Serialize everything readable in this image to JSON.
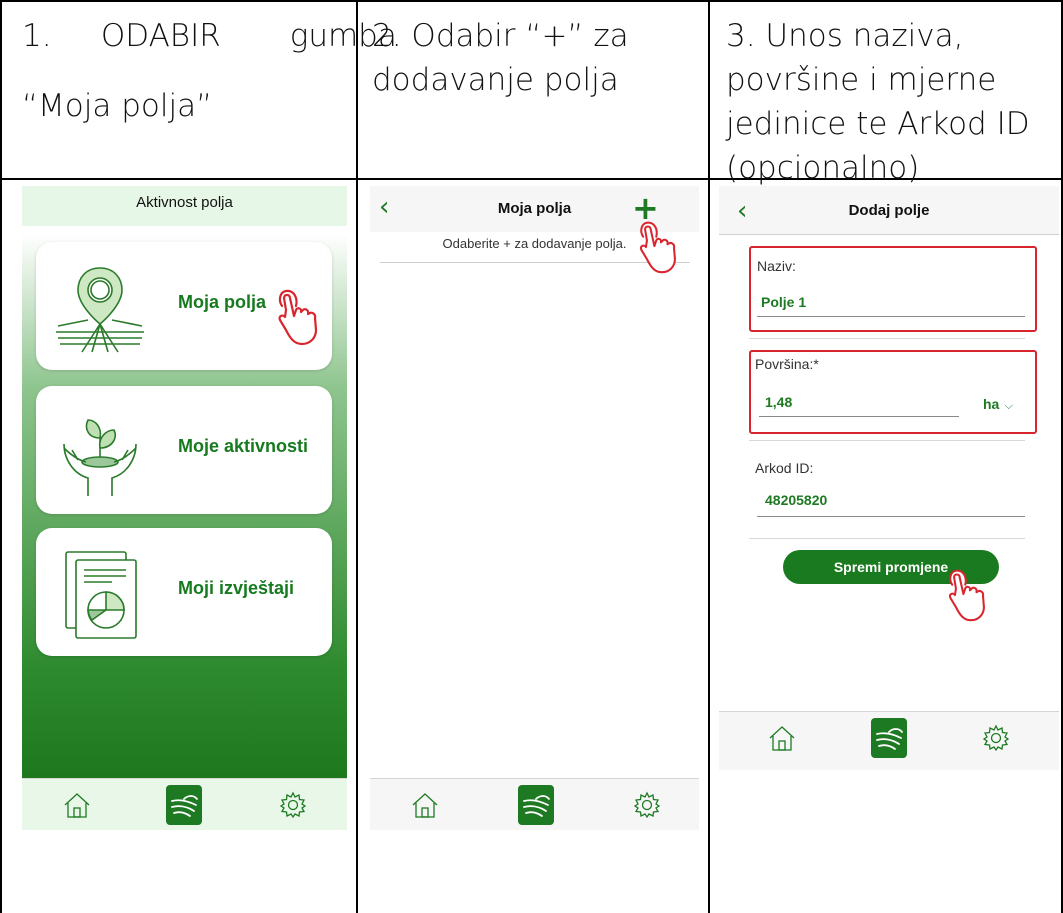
{
  "columns": [
    {
      "step_text": "1.     ODABIR       gumba",
      "step_text_2": "“Moja polja”"
    },
    {
      "step_text": "2. Odabir “+” za",
      "step_text_2": "dodavanje polja"
    },
    {
      "step_text": "3. Unos naziva,",
      "step_text_2": "površine i mjerne",
      "step_text_3": "jedinice te Arkod ID",
      "step_text_4": "(opcionalno)"
    }
  ],
  "screen1": {
    "title": "Aktivnost polja",
    "menu": [
      {
        "label": "Moja polja",
        "icon": "map-pin-field-icon"
      },
      {
        "label": "Moje aktivnosti",
        "icon": "hands-plant-icon"
      },
      {
        "label": "Moji izvještaji",
        "icon": "report-chart-icon"
      }
    ],
    "tabs": [
      "home-icon",
      "fields-icon",
      "settings-icon"
    ]
  },
  "screen2": {
    "title": "Moja polja",
    "add_label": "+",
    "hint": "Odaberite + za dodavanje polja."
  },
  "screen3": {
    "title": "Dodaj polje",
    "naziv_label": "Naziv:",
    "naziv_value": "Polje 1",
    "povrsina_label": "Površina:*",
    "povrsina_value": "1,48",
    "unit": "ha",
    "arkod_label": "Arkod ID:",
    "arkod_value": "48205820",
    "save_label": "Spremi promjene"
  },
  "colors": {
    "accent": "#1d7a22",
    "highlight": "#d9262e",
    "tabbar": "#e9f7e9"
  }
}
